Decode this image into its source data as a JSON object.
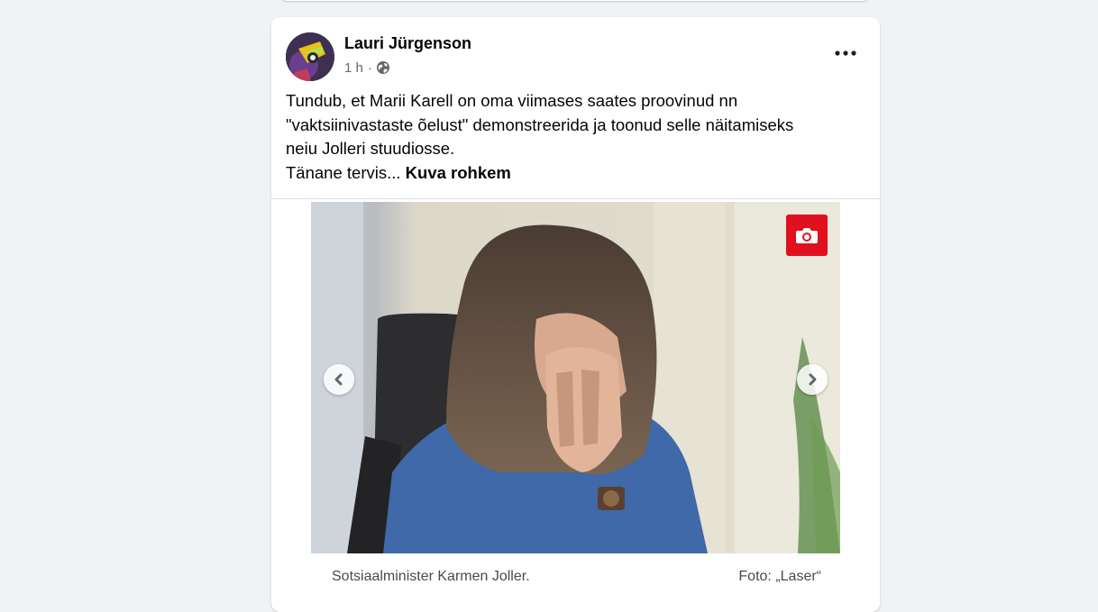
{
  "post": {
    "author": "Lauri Jürgenson",
    "time": "1 h",
    "meta_separator": "·",
    "privacy_icon": "globe-icon",
    "more_icon": "more-options-icon",
    "text_lines": [
      "Tundub, et Marii Karell on oma viimases saates proovinud nn",
      "\"vaktsiinivastaste õelust\" demonstreerida ja toonud selle näitamiseks",
      "neiu Jolleri stuudiosse."
    ],
    "truncated_line": "Tänane tervis...",
    "see_more": "Kuva rohkem"
  },
  "media": {
    "camera_badge_icon": "camera-icon",
    "prev_icon": "chevron-left-icon",
    "next_icon": "chevron-right-icon",
    "caption": "Sotsiaalminister Karmen Joller.",
    "credit": "Foto: „Laser“",
    "badge_color": "#e0101e"
  }
}
